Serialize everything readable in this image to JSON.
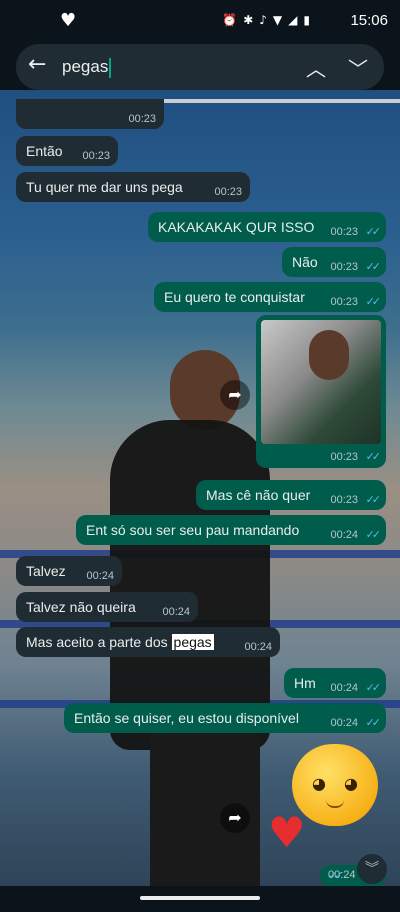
{
  "status_bar": {
    "time": "15:06",
    "icons": [
      "heart-icon",
      "alarm-icon",
      "bluetooth-icon",
      "mute-icon",
      "wifi-icon",
      "signal-icon",
      "battery-icon"
    ]
  },
  "search": {
    "query": "pegas",
    "icons": [
      "back-arrow-icon",
      "chevron-up-icon",
      "chevron-down-icon"
    ]
  },
  "messages": [
    {
      "dir": "in",
      "text": "",
      "time": "00:23"
    },
    {
      "dir": "in",
      "text": "Então",
      "time": "00:23"
    },
    {
      "dir": "in",
      "text": "Tu quer me dar uns pega",
      "time": "00:23"
    },
    {
      "dir": "out",
      "text": "KAKAKAKAK QUR ISSO",
      "time": "00:23"
    },
    {
      "dir": "out",
      "text": "Não",
      "time": "00:23"
    },
    {
      "dir": "out",
      "text": "Eu quero te conquistar",
      "time": "00:23"
    },
    {
      "dir": "out",
      "text": "[image]",
      "time": "00:23"
    },
    {
      "dir": "out",
      "text": "Mas cê não quer",
      "time": "00:23"
    },
    {
      "dir": "out",
      "text": "Ent só sou ser seu pau mandando",
      "time": "00:24"
    },
    {
      "dir": "in",
      "text": "Talvez",
      "time": "00:24"
    },
    {
      "dir": "in",
      "text": "Talvez não queira",
      "time": "00:24"
    },
    {
      "dir": "in",
      "text_before": "Mas aceito a parte dos ",
      "highlight": "pegas",
      "time": "00:24"
    },
    {
      "dir": "out",
      "text": "Hm",
      "time": "00:24"
    },
    {
      "dir": "out",
      "text": "Então se quiser, eu estou disponível",
      "time": "00:24"
    },
    {
      "dir": "out",
      "text": "[sticker]",
      "time": "00:24"
    }
  ],
  "colors": {
    "incoming_bubble": "#202c33",
    "outgoing_bubble": "#005c4b",
    "read_ticks": "#53bdeb",
    "accent": "#00a884"
  }
}
